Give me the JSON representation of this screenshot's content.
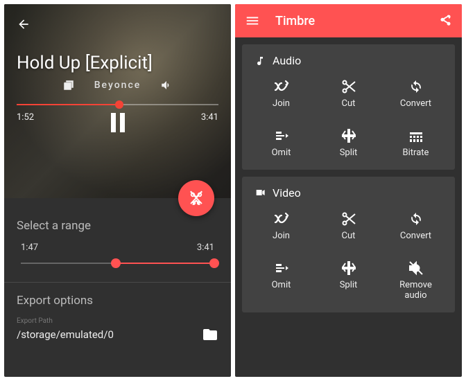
{
  "left": {
    "track": {
      "title": "Hold Up [Explicit]",
      "artist": "Beyonce"
    },
    "playback": {
      "elapsed": "1:52",
      "duration": "3:41"
    },
    "range": {
      "title": "Select a range",
      "start": "1:47",
      "end": "3:41"
    },
    "export": {
      "title": "Export options",
      "path_label": "Export Path",
      "path_value": "/storage/emulated/0"
    }
  },
  "right": {
    "app_title": "Timbre",
    "sections": {
      "audio": {
        "title": "Audio",
        "tiles": {
          "join": "Join",
          "cut": "Cut",
          "convert": "Convert",
          "omit": "Omit",
          "split": "Split",
          "bitrate": "Bitrate"
        }
      },
      "video": {
        "title": "Video",
        "tiles": {
          "join": "Join",
          "cut": "Cut",
          "convert": "Convert",
          "omit": "Omit",
          "split": "Split",
          "remove_audio": "Remove\naudio"
        }
      }
    }
  }
}
